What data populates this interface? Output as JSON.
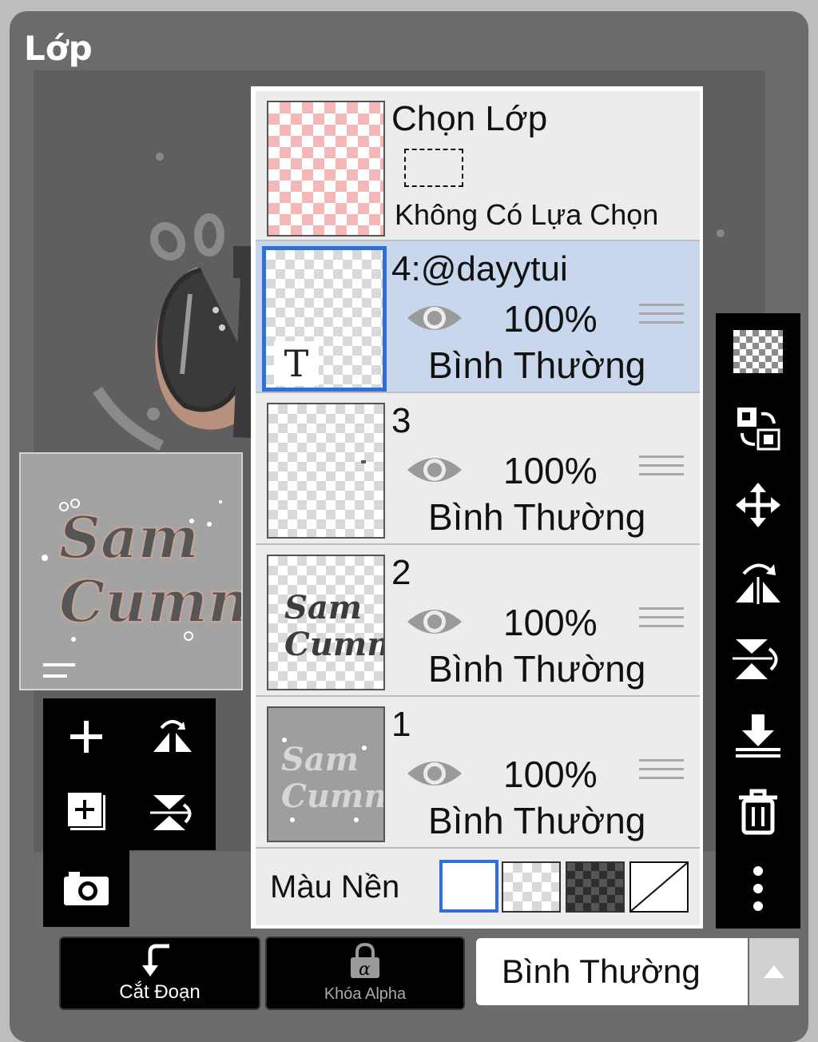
{
  "panel": {
    "title": "Lớp"
  },
  "selection_row": {
    "title": "Chọn Lớp",
    "status": "Không Có Lựa Chọn"
  },
  "layers": [
    {
      "name": "4:@dayytui",
      "opacity": "100%",
      "blend": "Bình Thường",
      "selected": true,
      "thumb_glyph": "T"
    },
    {
      "name": "3",
      "opacity": "100%",
      "blend": "Bình Thường",
      "selected": false
    },
    {
      "name": "2",
      "opacity": "100%",
      "blend": "Bình Thường",
      "selected": false
    },
    {
      "name": "1",
      "opacity": "100%",
      "blend": "Bình Thường",
      "selected": false
    }
  ],
  "background": {
    "label": "Màu Nền"
  },
  "bottom_bar": {
    "clip_label": "Cắt Đoạn",
    "alpha_lock_label": "Khóa Alpha",
    "blend_mode": "Bình Thường"
  },
  "artwork": {
    "line1": "Sam",
    "line2": "Cumn"
  },
  "colors": {
    "selected_row": "#c8d7ec",
    "accent": "#2f6fd6",
    "panel": "#6b6b6b"
  },
  "icons": {
    "left_tools": [
      "plus-icon",
      "flip-horizontal-icon",
      "add-layer-icon",
      "flip-vertical-icon",
      "camera-icon"
    ],
    "right_tools": [
      "transparency-icon",
      "swap-layers-icon",
      "move-icon",
      "flip-horizontal-icon",
      "flip-vertical-icon",
      "merge-down-icon",
      "trash-icon",
      "more-vertical-icon"
    ]
  }
}
